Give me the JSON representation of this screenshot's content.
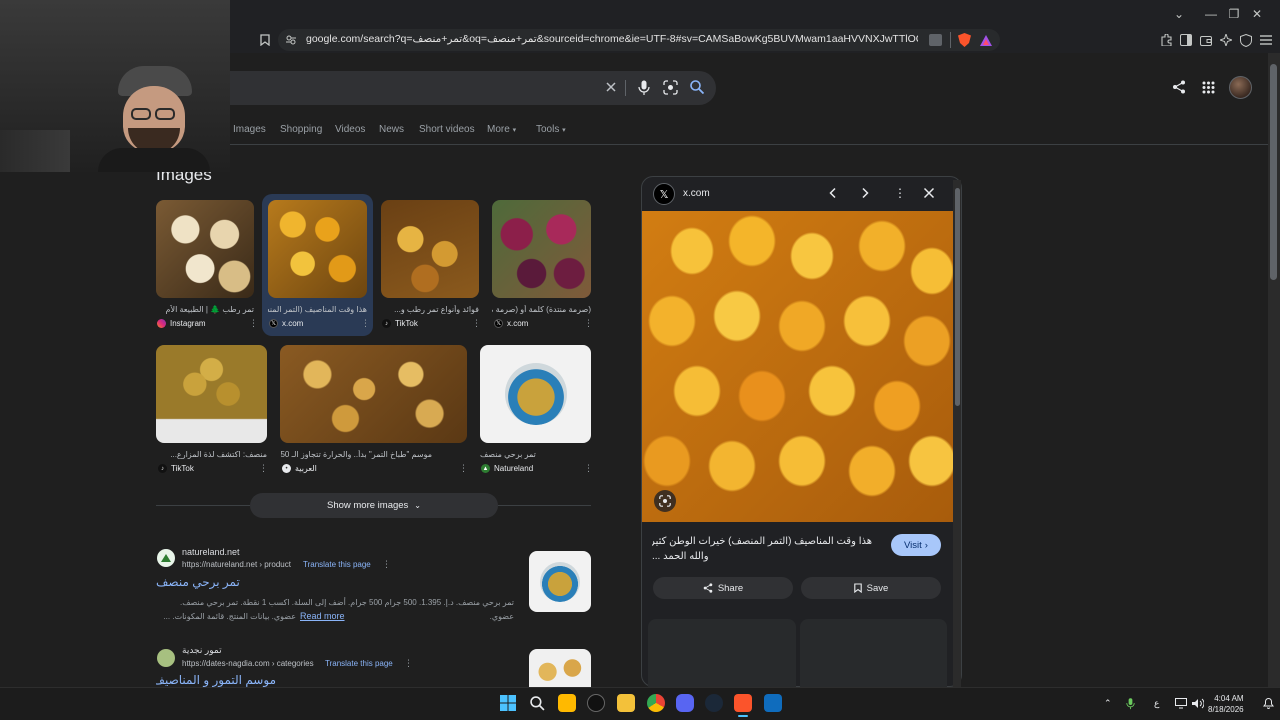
{
  "browser": {
    "url": "google.com/search?q=تمر+منصف&oq=تمر+منصف&sourceid=chrome&ie=UTF-8#sv=CAMSaBowKg5BUVMwam1aaHVVNXJwTTlOQVFTMGptWm..."
  },
  "search": {
    "tabs": [
      "Images",
      "Shopping",
      "Videos",
      "News",
      "Short videos",
      "More",
      "Tools"
    ]
  },
  "images_section": {
    "heading": "Images",
    "row1": [
      {
        "caption": "تمر رطب 🌲 | الطبيعة الأم",
        "source": "Instagram"
      },
      {
        "caption": "هذا وقت المناصيف (التمر المنصف)",
        "source": "x.com"
      },
      {
        "caption": "فوائد وأنواع تمر رطب و...",
        "source": "TikTok"
      },
      {
        "caption": "(صرمة منتدة) كلمة أو (صرمة منتدة)",
        "source": "x.com"
      }
    ],
    "row2": [
      {
        "caption": "منصف: اكتشف لذة المزارع...",
        "source": "TikTok"
      },
      {
        "caption": "موسم \"طباخ التمر\" بدأ.. والحرارة تتجاوز الـ 50",
        "source": "العربية"
      },
      {
        "caption": "تمر برحي منصف",
        "source": "Natureland"
      }
    ],
    "show_more": "Show more images"
  },
  "results": [
    {
      "site": "natureland.net",
      "url": "https://natureland.net › product",
      "translate": "Translate this page",
      "title": "تمر برحي منصف",
      "snippet1": "تمر برحي منصف. د.إ.‏ 1.395. ‏500 جرام 500 جرام. أضف إلى السلة. اكسب 1 نقطة. تمر برحي منصف. عضوي.",
      "snippet2": "عضوي. بيانات المنتج. قائمة المكونات. ...",
      "read_more": "Read more"
    },
    {
      "site": "تمور نجدية",
      "url": "https://dates-nagdia.com › categories",
      "translate": "Translate this page",
      "title": "موسم التمور و المناصيف"
    }
  ],
  "preview": {
    "source": "x.com",
    "title_line1": "هذا وقت المناصيف (التمر المنصف) خيرات الوطن كثيرة",
    "title_line2": "والله الحمد ...",
    "visit": "Visit",
    "share": "Share",
    "save": "Save"
  },
  "taskbar": {
    "time": "4:04 AM",
    "date": "8/18/2026",
    "lang": "ع"
  }
}
